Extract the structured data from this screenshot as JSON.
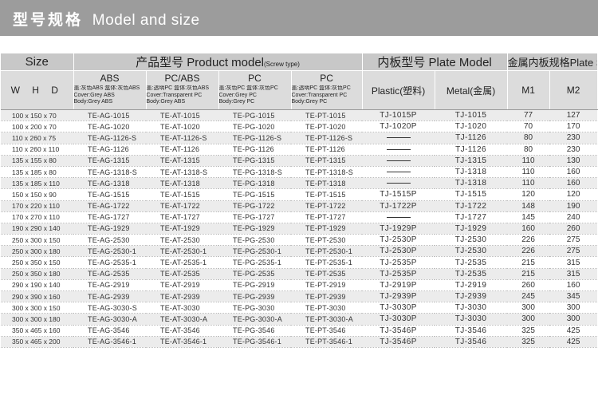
{
  "banner": {
    "title_cn": "型号规格",
    "title_en": "Model and size"
  },
  "header": {
    "size": "Size",
    "product_model": "产品型号 Product  model",
    "screw_type": "(Screw type)",
    "plate_model": "内板型号 Plate Model",
    "plate_size": "金属内板规格Plate Size",
    "whd": "W H D",
    "abs": "ABS",
    "pcabs": "PC/ABS",
    "pc1": "PC",
    "pc2": "PC",
    "plastic": "Plastic(塑料)",
    "metal": "Metal(金属)",
    "m1": "M1",
    "m2": "M2",
    "desc_abs": [
      "盖:灰色ABS 盒体:灰色ABS",
      "Cover:Grey ABS",
      "Body:Grey ABS"
    ],
    "desc_pcabs": [
      "盖:透明PC 盒体:灰色ABS",
      "Cover:Transparent PC",
      "Body:Grey ABS"
    ],
    "desc_pc1": [
      "盖:灰色PC 盒体:灰色PC",
      "Cover:Grey PC",
      "Body:Grey PC"
    ],
    "desc_pc2": [
      "盖:透明PC 盒体:灰色PC",
      "Cover:Transparent PC",
      "Body:Grey PC"
    ]
  },
  "rows": [
    {
      "size": "100 x 150 x 70",
      "abs": "TE-AG-1015",
      "pcabs": "TE-AT-1015",
      "pc1": "TE-PG-1015",
      "pc2": "TE-PT-1015",
      "plastic": "TJ-1015P",
      "metal": "TJ-1015",
      "m1": "77",
      "m2": "127"
    },
    {
      "size": "100 x 200 x 70",
      "abs": "TE-AG-1020",
      "pcabs": "TE-AT-1020",
      "pc1": "TE-PG-1020",
      "pc2": "TE-PT-1020",
      "plastic": "TJ-1020P",
      "metal": "TJ-1020",
      "m1": "70",
      "m2": "170"
    },
    {
      "size": "110 x 260 x 75",
      "abs": "TE-AG-1126-S",
      "pcabs": "TE-AT-1126-S",
      "pc1": "TE-PG-1126-S",
      "pc2": "TE-PT-1126-S",
      "plastic": "",
      "metal": "TJ-1126",
      "m1": "80",
      "m2": "230"
    },
    {
      "size": "110 x 260 x 110",
      "abs": "TE-AG-1126",
      "pcabs": "TE-AT-1126",
      "pc1": "TE-PG-1126",
      "pc2": "TE-PT-1126",
      "plastic": "",
      "metal": "TJ-1126",
      "m1": "80",
      "m2": "230"
    },
    {
      "size": "135 x 155 x 80",
      "abs": "TE-AG-1315",
      "pcabs": "TE-AT-1315",
      "pc1": "TE-PG-1315",
      "pc2": "TE-PT-1315",
      "plastic": "",
      "metal": "TJ-1315",
      "m1": "110",
      "m2": "130"
    },
    {
      "size": "135 x 185 x 80",
      "abs": "TE-AG-1318-S",
      "pcabs": "TE-AT-1318-S",
      "pc1": "TE-PG-1318-S",
      "pc2": "TE-PT-1318-S",
      "plastic": "",
      "metal": "TJ-1318",
      "m1": "110",
      "m2": "160"
    },
    {
      "size": "135 x 185 x 110",
      "abs": "TE-AG-1318",
      "pcabs": "TE-AT-1318",
      "pc1": "TE-PG-1318",
      "pc2": "TE-PT-1318",
      "plastic": "",
      "metal": "TJ-1318",
      "m1": "110",
      "m2": "160"
    },
    {
      "size": "150 x 150 x 90",
      "abs": "TE-AG-1515",
      "pcabs": "TE-AT-1515",
      "pc1": "TE-PG-1515",
      "pc2": "TE-PT-1515",
      "plastic": "TJ-1515P",
      "metal": "TJ-1515",
      "m1": "120",
      "m2": "120"
    },
    {
      "size": "170 x 220 x 110",
      "abs": "TE-AG-1722",
      "pcabs": "TE-AT-1722",
      "pc1": "TE-PG-1722",
      "pc2": "TE-PT-1722",
      "plastic": "TJ-1722P",
      "metal": "TJ-1722",
      "m1": "148",
      "m2": "190"
    },
    {
      "size": "170 x 270 x 110",
      "abs": "TE-AG-1727",
      "pcabs": "TE-AT-1727",
      "pc1": "TE-PG-1727",
      "pc2": "TE-PT-1727",
      "plastic": "",
      "metal": "TJ-1727",
      "m1": "145",
      "m2": "240"
    },
    {
      "size": "190 x 290 x 140",
      "abs": "TE-AG-1929",
      "pcabs": "TE-AT-1929",
      "pc1": "TE-PG-1929",
      "pc2": "TE-PT-1929",
      "plastic": "TJ-1929P",
      "metal": "TJ-1929",
      "m1": "160",
      "m2": "260"
    },
    {
      "size": "250 x 300 x 150",
      "abs": "TE-AG-2530",
      "pcabs": "TE-AT-2530",
      "pc1": "TE-PG-2530",
      "pc2": "TE-PT-2530",
      "plastic": "TJ-2530P",
      "metal": "TJ-2530",
      "m1": "226",
      "m2": "275"
    },
    {
      "size": "250 x 300 x 180",
      "abs": "TE-AG-2530-1",
      "pcabs": "TE-AT-2530-1",
      "pc1": "TE-PG-2530-1",
      "pc2": "TE-PT-2530-1",
      "plastic": "TJ-2530P",
      "metal": "TJ-2530",
      "m1": "226",
      "m2": "275"
    },
    {
      "size": "250 x 350 x 150",
      "abs": "TE-AG-2535-1",
      "pcabs": "TE-AT-2535-1",
      "pc1": "TE-PG-2535-1",
      "pc2": "TE-PT-2535-1",
      "plastic": "TJ-2535P",
      "metal": "TJ-2535",
      "m1": "215",
      "m2": "315"
    },
    {
      "size": "250 x 350 x 180",
      "abs": "TE-AG-2535",
      "pcabs": "TE-AT-2535",
      "pc1": "TE-PG-2535",
      "pc2": "TE-PT-2535",
      "plastic": "TJ-2535P",
      "metal": "TJ-2535",
      "m1": "215",
      "m2": "315"
    },
    {
      "size": "290 x 190 x 140",
      "abs": "TE-AG-2919",
      "pcabs": "TE-AT-2919",
      "pc1": "TE-PG-2919",
      "pc2": "TE-PT-2919",
      "plastic": "TJ-2919P",
      "metal": "TJ-2919",
      "m1": "260",
      "m2": "160"
    },
    {
      "size": "290 x 390 x 160",
      "abs": "TE-AG-2939",
      "pcabs": "TE-AT-2939",
      "pc1": "TE-PG-2939",
      "pc2": "TE-PT-2939",
      "plastic": "TJ-2939P",
      "metal": "TJ-2939",
      "m1": "245",
      "m2": "345"
    },
    {
      "size": "300 x 300 x 150",
      "abs": "TE-AG-3030-S",
      "pcabs": "TE-AT-3030",
      "pc1": "TE-PG-3030",
      "pc2": "TE-PT-3030",
      "plastic": "TJ-3030P",
      "metal": "TJ-3030",
      "m1": "300",
      "m2": "300"
    },
    {
      "size": "300 x 300 x 180",
      "abs": "TE-AG-3030-A",
      "pcabs": "TE-AT-3030-A",
      "pc1": "TE-PG-3030-A",
      "pc2": "TE-PT-3030-A",
      "plastic": "TJ-3030P",
      "metal": "TJ-3030",
      "m1": "300",
      "m2": "300"
    },
    {
      "size": "350 x 465 x 160",
      "abs": "TE-AG-3546",
      "pcabs": "TE-AT-3546",
      "pc1": "TE-PG-3546",
      "pc2": "TE-PT-3546",
      "plastic": "TJ-3546P",
      "metal": "TJ-3546",
      "m1": "325",
      "m2": "425"
    },
    {
      "size": "350 x 465 x 200",
      "abs": "TE-AG-3546-1",
      "pcabs": "TE-AT-3546-1",
      "pc1": "TE-PG-3546-1",
      "pc2": "TE-PT-3546-1",
      "plastic": "TJ-3546P",
      "metal": "TJ-3546",
      "m1": "325",
      "m2": "425"
    }
  ]
}
